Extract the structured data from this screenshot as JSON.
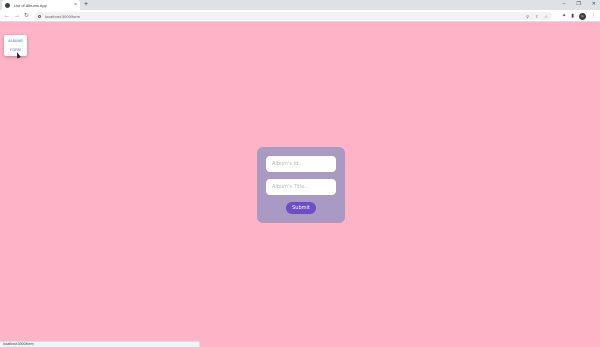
{
  "browser": {
    "tab_title": "List of Albums App",
    "tab_close": "×",
    "new_tab": "+",
    "window_controls": [
      "–",
      "❐",
      "✕"
    ],
    "url": "localhost:3000/form",
    "nav_buttons": [
      "←",
      "→",
      "↻"
    ],
    "omnibox_icons": [
      "⚲",
      "⇪",
      "☆"
    ],
    "toolbar_icons": [
      "✦",
      "▮"
    ],
    "avatar_text": "G",
    "menu_icon": "⋮"
  },
  "nav": {
    "items": [
      "ALBUMS",
      "FORM"
    ]
  },
  "form": {
    "id_placeholder": "Album's Id...",
    "title_placeholder": "Album's Title...",
    "submit_label": "Submit"
  },
  "status_bar": {
    "url": "localhost:3000/form"
  },
  "colors": {
    "page_background": "#ffb3c7",
    "card_background": "#a89ac2",
    "submit_button": "#6c4fc4",
    "link": "#3a6fd8"
  }
}
